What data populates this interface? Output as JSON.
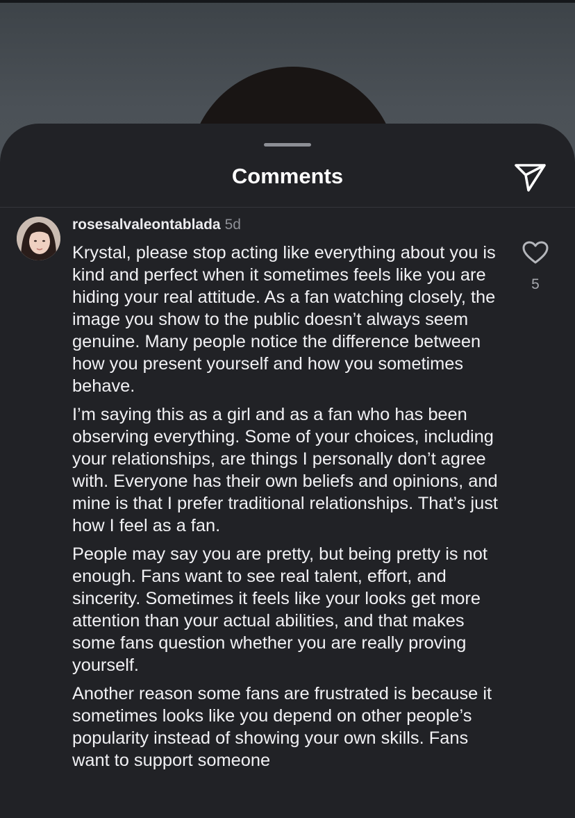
{
  "sheet": {
    "title": "Comments",
    "share_icon": "send-icon"
  },
  "comment": {
    "username": "rosesalvaleontablada",
    "age": "5d",
    "avatar_icon": "user-avatar",
    "paragraphs": [
      "Krystal, please stop acting like everything about you is kind and perfect when it sometimes feels like you are hiding your real attitude. As a fan watching closely, the image you show to the public doesn’t always seem genuine. Many people notice the difference between how you present yourself and how you sometimes behave.",
      "I’m saying this as a girl and as a fan who has been observing everything. Some of your choices, including your relationships, are things I personally don’t agree with. Everyone has their own beliefs and opinions, and mine is that I prefer traditional relationships. That’s just how I feel as a fan.",
      "People may say you are pretty, but being pretty is not enough. Fans want to see real talent, effort, and sincerity. Sometimes it feels like your looks get more attention than your actual abilities, and that makes some fans question whether you are really proving yourself.",
      "Another reason some fans are frustrated is because it sometimes looks like you depend on other people’s popularity instead of showing your own skills. Fans want to support someone"
    ],
    "like_icon": "heart-icon",
    "like_count": "5"
  },
  "colors": {
    "sheet_bg": "#212226",
    "text": "#f1f1f4",
    "muted": "#8e9097"
  }
}
